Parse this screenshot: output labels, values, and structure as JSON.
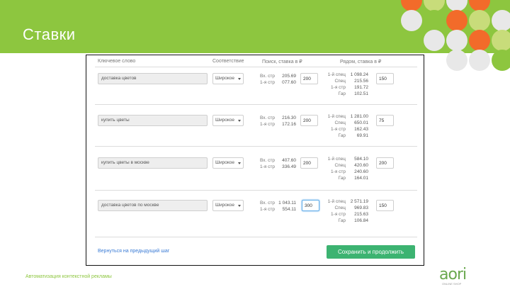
{
  "slide": {
    "title": "Ставки",
    "footer": "Автоматизация контекстной рекламы",
    "logo": "aori",
    "logo_subtitle": "ONLINE SHOP"
  },
  "table": {
    "headers": [
      "Ключевое слово",
      "Соответствие",
      "Поиск, ставка в ₽",
      "Рядом, ставка в ₽"
    ],
    "match_caret_icon": "caret-down-icon",
    "rows": [
      {
        "keyword": "доставка цветов",
        "match": "Широкое",
        "search": [
          {
            "label": "Вх. стр",
            "value": "205.69"
          },
          {
            "label": "1-я стр",
            "value": "077.60"
          }
        ],
        "search_bid": "200",
        "network": [
          {
            "label": "1-й спец",
            "value": "1 098.24"
          },
          {
            "label": "Спец",
            "value": "215.56"
          },
          {
            "label": "1-я стр",
            "value": "191.72"
          },
          {
            "label": "Гар",
            "value": "102.51"
          }
        ],
        "network_bid": "150"
      },
      {
        "keyword": "купить цветы",
        "match": "Широкое",
        "search": [
          {
            "label": "Вх. стр",
            "value": "216.30"
          },
          {
            "label": "1-я стр",
            "value": "172.16"
          }
        ],
        "search_bid": "200",
        "network": [
          {
            "label": "1-й спец",
            "value": "1 281.00"
          },
          {
            "label": "Спец",
            "value": "650.01"
          },
          {
            "label": "1-я стр",
            "value": "162.43"
          },
          {
            "label": "Гар",
            "value": "69.91"
          }
        ],
        "network_bid": "75"
      },
      {
        "keyword": "купить цветы в москве",
        "match": "Широкое",
        "search": [
          {
            "label": "Вх. стр",
            "value": "407.60"
          },
          {
            "label": "1-я стр",
            "value": "336.49"
          }
        ],
        "search_bid": "200",
        "network": [
          {
            "label": "1-й спец",
            "value": "584.10"
          },
          {
            "label": "Спец",
            "value": "420.60"
          },
          {
            "label": "1-я стр",
            "value": "240.60"
          },
          {
            "label": "Гар",
            "value": "164.01"
          }
        ],
        "network_bid": "200"
      },
      {
        "keyword": "доставка цветов по москве",
        "match": "Широкое",
        "search": [
          {
            "label": "Вх. стр",
            "value": "1 043.11"
          },
          {
            "label": "1-я стр",
            "value": "554.11"
          }
        ],
        "search_bid": "300",
        "network": [
          {
            "label": "1-й спец",
            "value": "2 571.19"
          },
          {
            "label": "Спец",
            "value": "969.83"
          },
          {
            "label": "1-я стр",
            "value": "215.63"
          },
          {
            "label": "Гар",
            "value": "106.84"
          }
        ],
        "network_bid": "150"
      }
    ]
  },
  "actions": {
    "back_label": "Вернуться на предыдущий шаг",
    "save_label": "Сохранить и продолжить"
  },
  "colors": {
    "header_green": "#8dc63f",
    "accent_orange": "#f26b2a",
    "light_green": "#c8dc7a",
    "button_green": "#3cb371",
    "link_blue": "#3a7bd5"
  }
}
